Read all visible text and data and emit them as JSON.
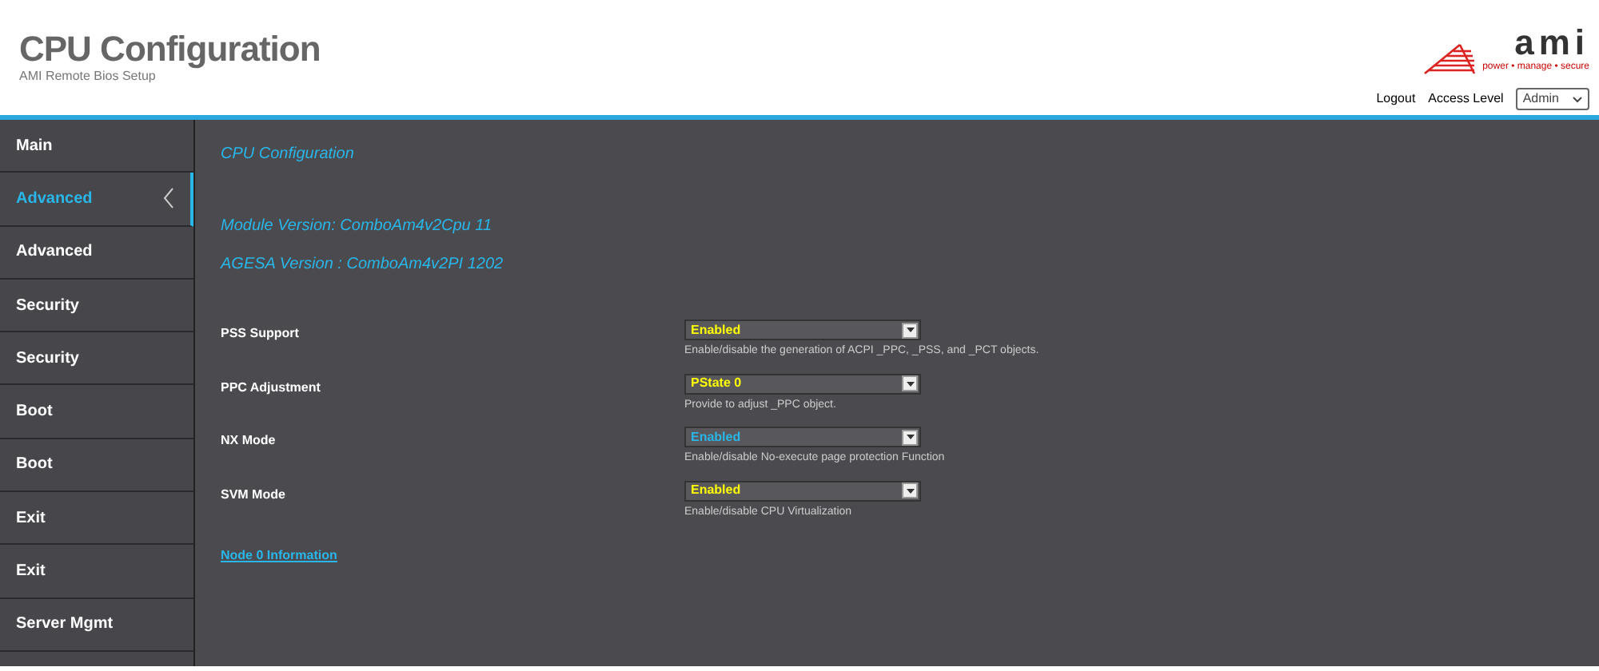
{
  "header": {
    "title": "CPU Configuration",
    "subtitle": "AMI Remote Bios Setup",
    "logo": {
      "name": "ami",
      "tagline": "power • manage • secure"
    },
    "logout": "Logout",
    "access_label": "Access Level",
    "access_value": "Admin"
  },
  "sidebar": {
    "items": [
      {
        "label": "Main",
        "selected": false
      },
      {
        "label": "Advanced",
        "selected": true
      },
      {
        "label": "Advanced",
        "selected": false
      },
      {
        "label": "Security",
        "selected": false
      },
      {
        "label": "Security",
        "selected": false
      },
      {
        "label": "Boot",
        "selected": false
      },
      {
        "label": "Boot",
        "selected": false
      },
      {
        "label": "Exit",
        "selected": false
      },
      {
        "label": "Exit",
        "selected": false
      },
      {
        "label": "Server Mgmt",
        "selected": false
      }
    ]
  },
  "content": {
    "heading": "CPU Configuration",
    "info": [
      "Module Version: ComboAm4v2Cpu 11",
      "AGESA Version : ComboAm4v2PI 1202"
    ],
    "settings": [
      {
        "label": "PSS Support",
        "value": "Enabled",
        "help": "Enable/disable the generation of ACPI _PPC, _PSS, and _PCT objects.",
        "focused": false
      },
      {
        "label": "PPC Adjustment",
        "value": "PState 0",
        "help": "Provide to adjust _PPC object.",
        "focused": false
      },
      {
        "label": "NX Mode",
        "value": "Enabled",
        "help": "Enable/disable No-execute page protection Function",
        "focused": true
      },
      {
        "label": "SVM Mode",
        "value": "Enabled",
        "help": "Enable/disable CPU Virtualization",
        "focused": false
      }
    ],
    "link": "Node 0 Information"
  }
}
